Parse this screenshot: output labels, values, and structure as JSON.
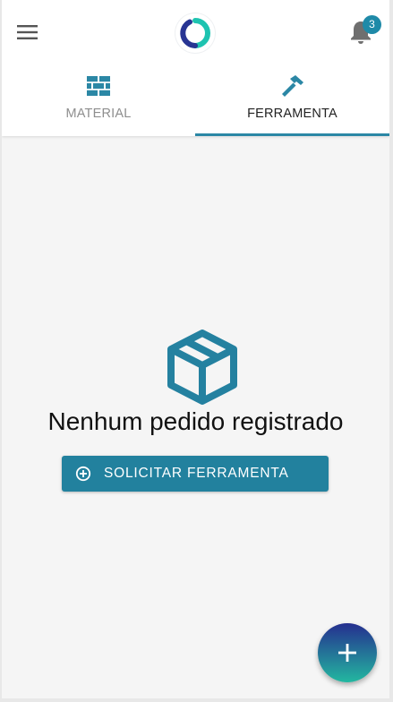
{
  "header": {
    "notifications_count": "3",
    "icons": {
      "menu": "hamburger-menu-icon",
      "logo": "app-logo",
      "notifications": "bell-icon"
    }
  },
  "tabs": [
    {
      "label": "MATERIAL",
      "icon": "brick-wall-icon",
      "active": false
    },
    {
      "label": "FERRAMENTA",
      "icon": "hammer-icon",
      "active": true
    }
  ],
  "empty_state": {
    "icon": "package-box-icon",
    "message": "Nenhum pedido registrado",
    "button_label": "SOLICITAR FERRAMENTA",
    "button_icon": "plus-circle-icon"
  },
  "fab": {
    "icon": "plus-icon"
  },
  "colors": {
    "primary": "#22819e",
    "tab_indicator": "#2b87a5",
    "badge": "#1f8aa8",
    "fab_gradient_top": "#252f8f",
    "fab_gradient_bottom": "#23b7a0",
    "background": "#f5f5f5"
  }
}
